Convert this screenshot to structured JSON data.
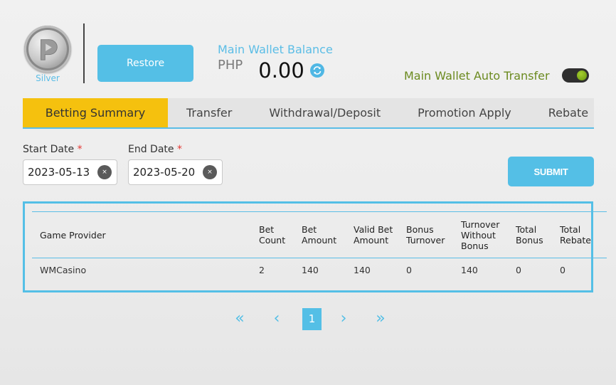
{
  "header": {
    "tier_label": "Silver",
    "restore_label": "Restore",
    "wallet_title": "Main Wallet Balance",
    "currency": "PHP",
    "balance": "0.00",
    "auto_transfer_label": "Main Wallet Auto Transfer",
    "auto_transfer_on": true
  },
  "tabs": [
    {
      "label": "Betting Summary",
      "active": true
    },
    {
      "label": "Transfer",
      "active": false
    },
    {
      "label": "Withdrawal/Deposit",
      "active": false
    },
    {
      "label": "Promotion Apply",
      "active": false
    },
    {
      "label": "Rebate",
      "active": false
    }
  ],
  "filter": {
    "start_label": "Start Date",
    "start_value": "2023-05-13",
    "end_label": "End Date",
    "end_value": "2023-05-20",
    "required_mark": "*",
    "clear_glyph": "×",
    "submit_label": "SUBMIT"
  },
  "table": {
    "columns": [
      "Game Provider",
      "Bet Count",
      "Bet Amount",
      "Valid Bet Amount",
      "Bonus Turnover",
      "Turnover Without Bonus",
      "Total Bonus",
      "Total Rebate"
    ],
    "rows": [
      [
        "WMCasino",
        "2",
        "140",
        "140",
        "0",
        "140",
        "0",
        "0"
      ]
    ]
  },
  "pagination": {
    "first": "«",
    "prev": "‹",
    "current": "1",
    "next": "›",
    "last": "»"
  },
  "colors": {
    "accent": "#54bfe6",
    "active_tab": "#f5c10e",
    "auto_transfer_text": "#6b8a1f"
  }
}
